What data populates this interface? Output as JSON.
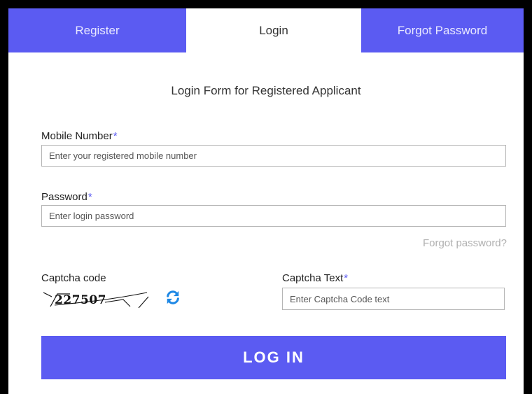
{
  "tabs": {
    "register": "Register",
    "login": "Login",
    "forgot": "Forgot Password"
  },
  "form": {
    "title": "Login Form for Registered Applicant",
    "mobile": {
      "label": "Mobile Number",
      "required_mark": "*",
      "placeholder": "Enter your registered mobile number"
    },
    "password": {
      "label": "Password",
      "required_mark": "*",
      "placeholder": "Enter login password"
    },
    "forgot_link": "Forgot password?",
    "captcha": {
      "label": "Captcha code",
      "image_text": "227507",
      "refresh_icon": "refresh-icon"
    },
    "captcha_text": {
      "label": "Captcha Text",
      "required_mark": "*",
      "placeholder": "Enter Captcha Code text"
    },
    "submit_label": "LOG IN"
  },
  "colors": {
    "accent": "#5b5bf2",
    "link_muted": "#b0b0b0",
    "refresh_icon": "#1e88e5"
  }
}
